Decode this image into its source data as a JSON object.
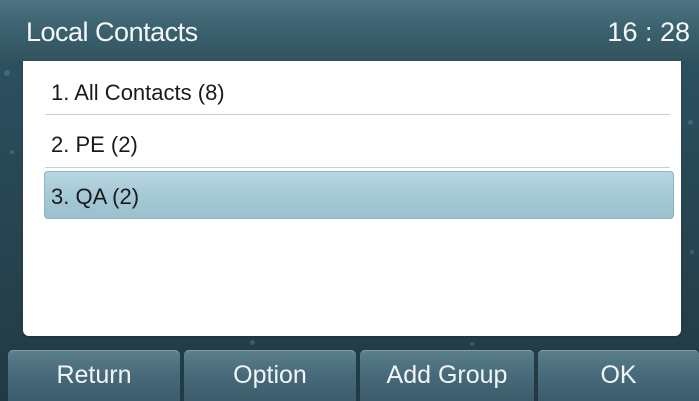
{
  "header": {
    "title": "Local Contacts",
    "time": "16 : 28"
  },
  "groups": [
    {
      "label": "1. All Contacts (8)"
    },
    {
      "label": "2. PE (2)"
    },
    {
      "label": "3. QA (2)",
      "selected": true
    }
  ],
  "softkeys": {
    "return_label": "Return",
    "option_label": "Option",
    "add_group_label": "Add Group",
    "ok_label": "OK"
  },
  "colors": {
    "titlebar": "#3c6270",
    "background": "#2a4a58",
    "selected_row": "#a4c8d5",
    "softkey": "#47697a"
  }
}
